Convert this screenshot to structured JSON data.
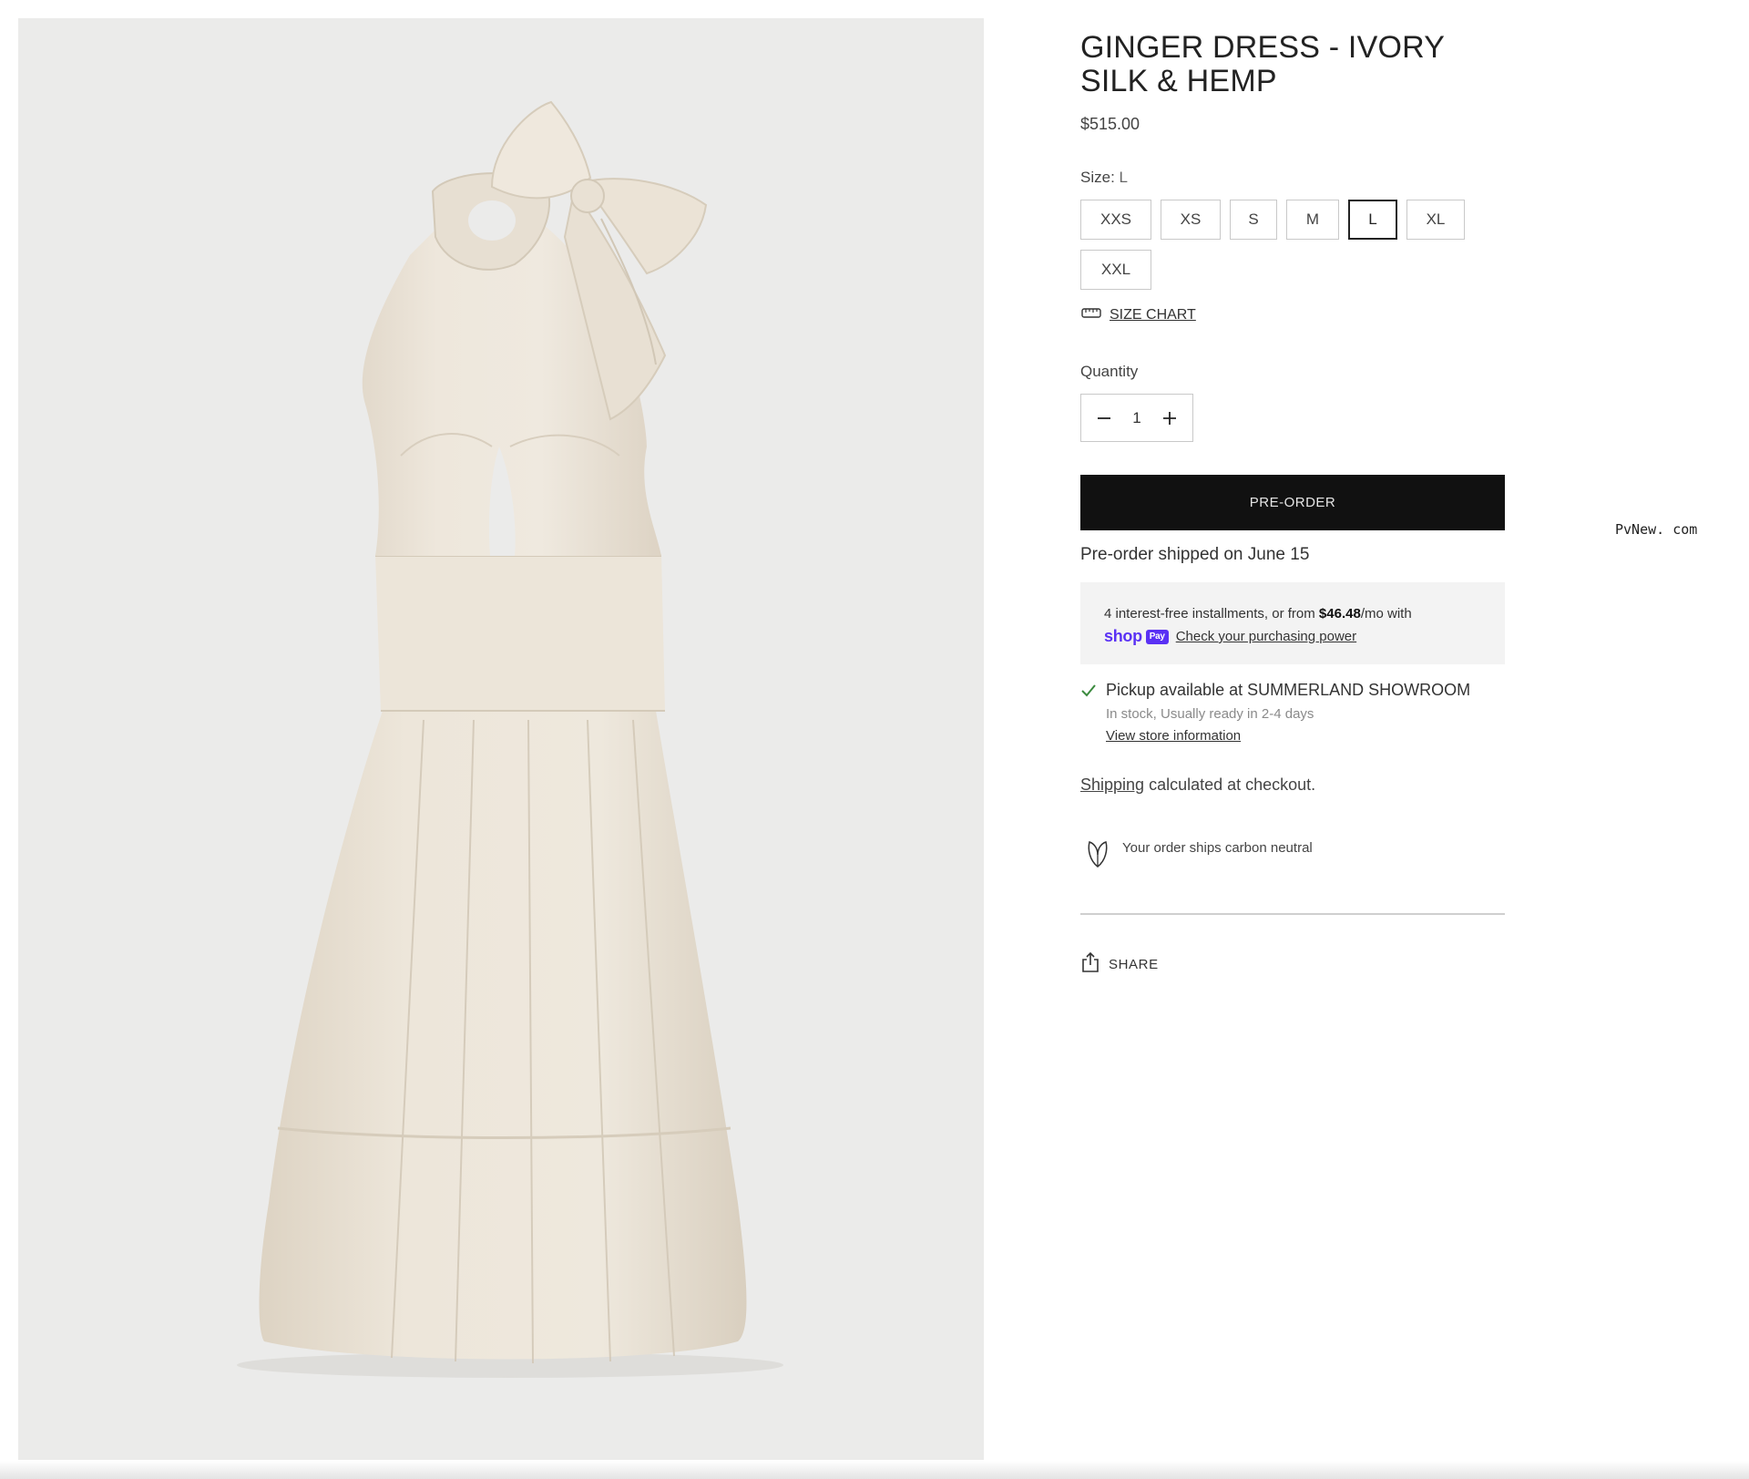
{
  "product": {
    "title": "GINGER DRESS - IVORY SILK & HEMP",
    "price": "$515.00",
    "image_alt": "Ivory halter neck midi dress with bow"
  },
  "size": {
    "label": "Size:",
    "selected": "L",
    "options": [
      "XXS",
      "XS",
      "S",
      "M",
      "L",
      "XL",
      "XXL"
    ],
    "size_chart_label": "SIZE CHART"
  },
  "quantity": {
    "label": "Quantity",
    "value": "1"
  },
  "cta": {
    "preorder_label": "PRE-ORDER",
    "shipping_note": "Pre-order shipped on June 15"
  },
  "shop_pay": {
    "text_before": "4 interest-free installments, or from ",
    "amount": "$46.48",
    "text_after": "/mo with",
    "logo_word": "shop",
    "logo_badge": "Pay",
    "link": "Check your purchasing power",
    "brand_color": "#5a31f4"
  },
  "pickup": {
    "line1": "Pickup available at SUMMERLAND SHOWROOM",
    "line2": "In stock, Usually ready in 2-4 days",
    "link": "View store information",
    "check_color": "#3b8a3e"
  },
  "shipping": {
    "link": "Shipping",
    "text": " calculated at checkout."
  },
  "carbon": {
    "text": "Your order ships carbon neutral"
  },
  "share": {
    "label": "SHARE"
  },
  "watermark": "PvNew. com",
  "icons": {
    "size_chart": "ruler-icon",
    "minus": "minus-icon",
    "plus": "plus-icon",
    "check": "checkmark-icon",
    "carbon": "leaf-icon",
    "share": "share-icon"
  }
}
